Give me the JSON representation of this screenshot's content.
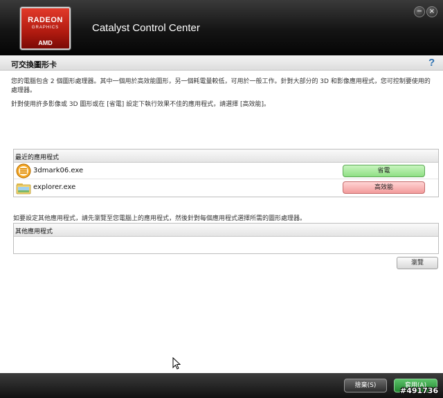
{
  "header": {
    "logo": {
      "line1": "RADEON",
      "line2": "GRAPHICS",
      "brand": "AMD"
    },
    "title": "Catalyst Control Center"
  },
  "section": {
    "title": "可交換圖形卡"
  },
  "description": {
    "line1": "您的電腦包含 2 個圖形處理器。其中一個用於高效能圖形，另一個耗電量較低，可用於一般工作。針對大部分的 3D 和影像應用程式，您可控制要使用的處理器。",
    "line2": "針對使用許多影像或 3D 圖形或在 [省電] 設定下執行效果不佳的應用程式，請選擇 [高效能]。"
  },
  "recent_apps": {
    "header": "最近的應用程式",
    "items": [
      {
        "name": "3dmark06.exe",
        "mode": "省電",
        "icon": "3dmark-icon"
      },
      {
        "name": "explorer.exe",
        "mode": "高效能",
        "icon": "folder-icon"
      }
    ]
  },
  "other_apps": {
    "description": "如要設定其他應用程式，請先瀏覽至您電腦上的應用程式，然後針對每個應用程式選擇所需的圖形處理器。",
    "header": "其他應用程式",
    "browse_label": "瀏覽"
  },
  "footer": {
    "discard_label": "捨棄(S)",
    "apply_label": "套用(A)"
  },
  "watermark": "#491736",
  "colors": {
    "power_saving": "#8fdf84",
    "high_performance": "#f29b9b",
    "apply": "#21862f",
    "accent": "#b01a10"
  }
}
